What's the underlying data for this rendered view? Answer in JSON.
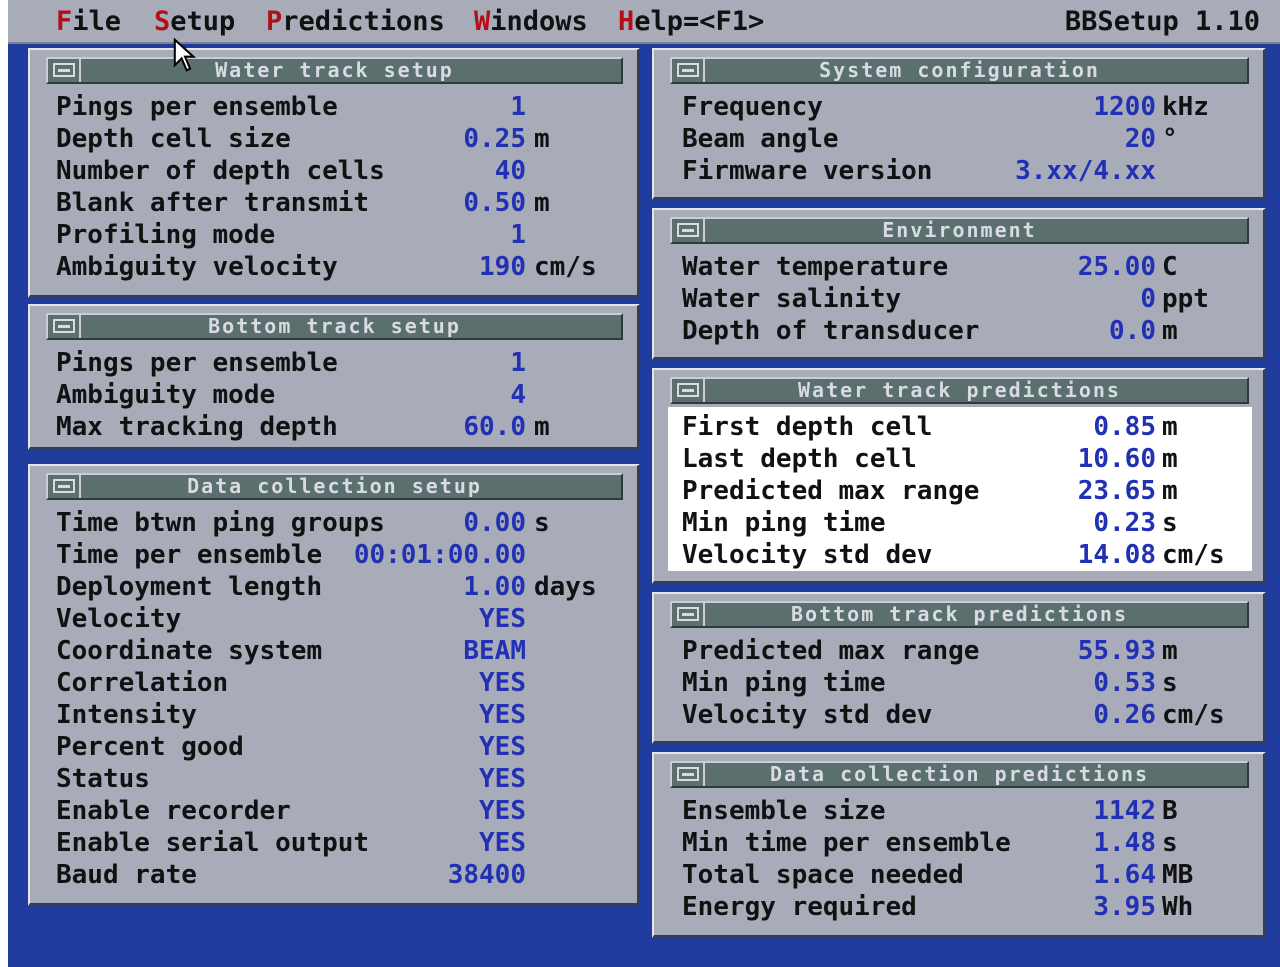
{
  "menubar": {
    "items": [
      {
        "hotkey": "F",
        "rest": "ile"
      },
      {
        "hotkey": "S",
        "rest": "etup"
      },
      {
        "hotkey": "P",
        "rest": "redictions"
      },
      {
        "hotkey": "W",
        "rest": "indows"
      },
      {
        "hotkey": "H",
        "rest": "elp=<F1>"
      }
    ],
    "app_title": "BBSetup 1.10"
  },
  "water_track_setup": {
    "title": "Water track setup",
    "rows": [
      {
        "label": "Pings per ensemble",
        "value": "1",
        "unit": ""
      },
      {
        "label": "Depth cell size",
        "value": "0.25",
        "unit": "m"
      },
      {
        "label": "Number of depth cells",
        "value": "40",
        "unit": ""
      },
      {
        "label": "Blank after transmit",
        "value": "0.50",
        "unit": "m"
      },
      {
        "label": "Profiling mode",
        "value": "1",
        "unit": ""
      },
      {
        "label": "Ambiguity velocity",
        "value": "190",
        "unit": "cm/s"
      }
    ]
  },
  "bottom_track_setup": {
    "title": "Bottom track setup",
    "rows": [
      {
        "label": "Pings per ensemble",
        "value": "1",
        "unit": ""
      },
      {
        "label": "Ambiguity mode",
        "value": "4",
        "unit": ""
      },
      {
        "label": "Max tracking depth",
        "value": "60.0",
        "unit": "m"
      }
    ]
  },
  "data_collection_setup": {
    "title": "Data collection setup",
    "rows": [
      {
        "label": "Time btwn ping groups",
        "value": "0.00",
        "unit": "s"
      },
      {
        "label": "Time per ensemble",
        "value": "00:01:00.00",
        "unit": ""
      },
      {
        "label": "Deployment length",
        "value": "1.00",
        "unit": "days"
      },
      {
        "label": "Velocity",
        "value": "YES",
        "unit": ""
      },
      {
        "label": "Coordinate system",
        "value": "BEAM",
        "unit": ""
      },
      {
        "label": "Correlation",
        "value": "YES",
        "unit": ""
      },
      {
        "label": "Intensity",
        "value": "YES",
        "unit": ""
      },
      {
        "label": "Percent good",
        "value": "YES",
        "unit": ""
      },
      {
        "label": "Status",
        "value": "YES",
        "unit": ""
      },
      {
        "label": "Enable recorder",
        "value": "YES",
        "unit": ""
      },
      {
        "label": "Enable serial output",
        "value": "YES",
        "unit": ""
      },
      {
        "label": "Baud rate",
        "value": "38400",
        "unit": ""
      }
    ]
  },
  "system_configuration": {
    "title": "System configuration",
    "rows": [
      {
        "label": "Frequency",
        "value": "1200",
        "unit": "kHz"
      },
      {
        "label": "Beam angle",
        "value": "20",
        "unit": "°"
      },
      {
        "label": "Firmware version",
        "value": "3.xx/4.xx",
        "unit": ""
      }
    ]
  },
  "environment": {
    "title": "Environment",
    "rows": [
      {
        "label": "Water temperature",
        "value": "25.00",
        "unit": "C"
      },
      {
        "label": "Water salinity",
        "value": "0",
        "unit": "ppt"
      },
      {
        "label": "Depth of transducer",
        "value": "0.0",
        "unit": "m"
      }
    ]
  },
  "water_track_predictions": {
    "title": "Water track predictions",
    "rows": [
      {
        "label": "First depth cell",
        "value": "0.85",
        "unit": "m"
      },
      {
        "label": "Last depth cell",
        "value": "10.60",
        "unit": "m"
      },
      {
        "label": "Predicted max range",
        "value": "23.65",
        "unit": "m"
      },
      {
        "label": "Min ping time",
        "value": "0.23",
        "unit": "s"
      },
      {
        "label": "Velocity std dev",
        "value": "14.08",
        "unit": "cm/s"
      }
    ]
  },
  "bottom_track_predictions": {
    "title": "Bottom track predictions",
    "rows": [
      {
        "label": "Predicted max range",
        "value": "55.93",
        "unit": "m"
      },
      {
        "label": "Min ping time",
        "value": "0.53",
        "unit": "s"
      },
      {
        "label": "Velocity std dev",
        "value": "0.26",
        "unit": "cm/s"
      }
    ]
  },
  "data_collection_predictions": {
    "title": "Data collection predictions",
    "rows": [
      {
        "label": "Ensemble size",
        "value": "1142",
        "unit": "B"
      },
      {
        "label": "Min time per ensemble",
        "value": "1.48",
        "unit": "s"
      },
      {
        "label": "Total space needed",
        "value": "1.64",
        "unit": "MB"
      },
      {
        "label": "Energy required",
        "value": "3.95",
        "unit": "Wh"
      }
    ]
  },
  "colors": {
    "desktop": "#1f3b9e",
    "panel": "#a8acb8",
    "value_text": "#2230b4",
    "hotkey": "#b20e16",
    "title_bar": "#5b6f6f"
  }
}
